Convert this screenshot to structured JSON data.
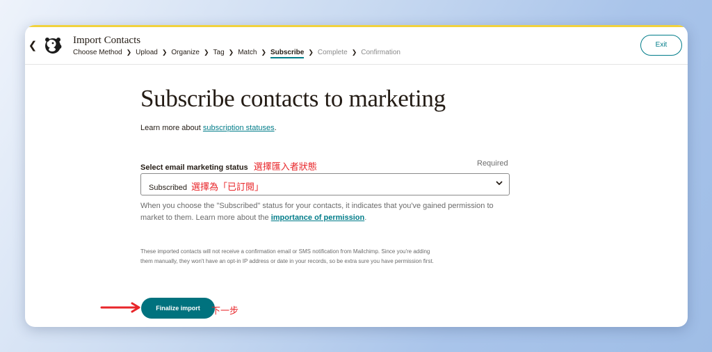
{
  "header": {
    "title": "Import Contacts",
    "steps": [
      {
        "label": "Choose Method",
        "state": "done"
      },
      {
        "label": "Upload",
        "state": "done"
      },
      {
        "label": "Organize",
        "state": "done"
      },
      {
        "label": "Tag",
        "state": "done"
      },
      {
        "label": "Match",
        "state": "done"
      },
      {
        "label": "Subscribe",
        "state": "active"
      },
      {
        "label": "Complete",
        "state": "future"
      },
      {
        "label": "Confirmation",
        "state": "future"
      }
    ],
    "exit_label": "Exit"
  },
  "main": {
    "heading": "Subscribe contacts to marketing",
    "learn_prefix": "Learn more about ",
    "learn_link": "subscription statuses",
    "learn_suffix": ".",
    "field_label": "Select email marketing status",
    "field_annotation": "選擇匯入者狀態",
    "required": "Required",
    "select_value": "Subscribed",
    "select_annotation": "選擇為「已訂閱」",
    "help_text": "When you choose the \"Subscribed\" status for your contacts, it indicates that you've gained permission to market to them. Learn more about the ",
    "help_link": "importance of permission",
    "help_suffix": ".",
    "note": "These imported contacts will not receive a confirmation email or SMS notification from Mailchimp. Since you're adding them manually, they won't have an opt-in IP address or date in your records, so be extra sure you have permission first.",
    "finalize_label": "Finalize import",
    "next_annotation": "下一步"
  },
  "colors": {
    "accent": "#007c89",
    "annotation": "#e8262a",
    "top_stripe": "#f1d23d"
  },
  "icons": [
    "chevron-left-icon",
    "mailchimp-logo",
    "chevron-right-icon",
    "chevron-down-icon",
    "red-arrow-annotation"
  ]
}
